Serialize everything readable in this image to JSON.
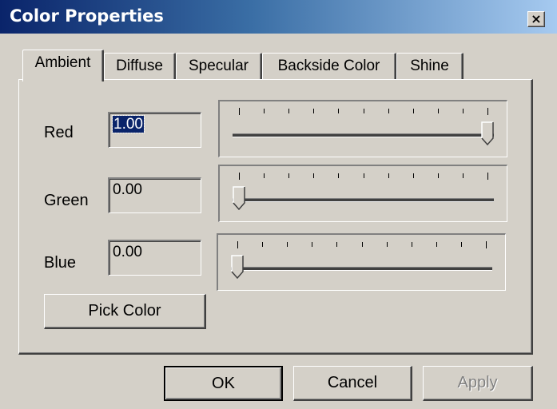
{
  "window": {
    "title": "Color Properties",
    "close_glyph": "×"
  },
  "tabs": [
    {
      "label": "Ambient",
      "selected": true
    },
    {
      "label": "Diffuse",
      "selected": false
    },
    {
      "label": "Specular",
      "selected": false
    },
    {
      "label": "Backside Color",
      "selected": false
    },
    {
      "label": "Shine",
      "selected": false
    }
  ],
  "channels": {
    "red": {
      "label": "Red",
      "value": "1.00",
      "level": 1.0,
      "selected_text": true
    },
    "green": {
      "label": "Green",
      "value": "0.00",
      "level": 0.0,
      "selected_text": false
    },
    "blue": {
      "label": "Blue",
      "value": "0.00",
      "level": 0.0,
      "selected_text": false
    }
  },
  "slider_tick_count": 11,
  "buttons": {
    "pick_color": "Pick Color",
    "ok": "OK",
    "cancel": "Cancel",
    "apply": "Apply",
    "apply_enabled": false
  },
  "colors": {
    "face": "#d4d0c8",
    "title_start": "#0a246a",
    "title_end": "#a6caf0",
    "selection": "#0a246a"
  }
}
